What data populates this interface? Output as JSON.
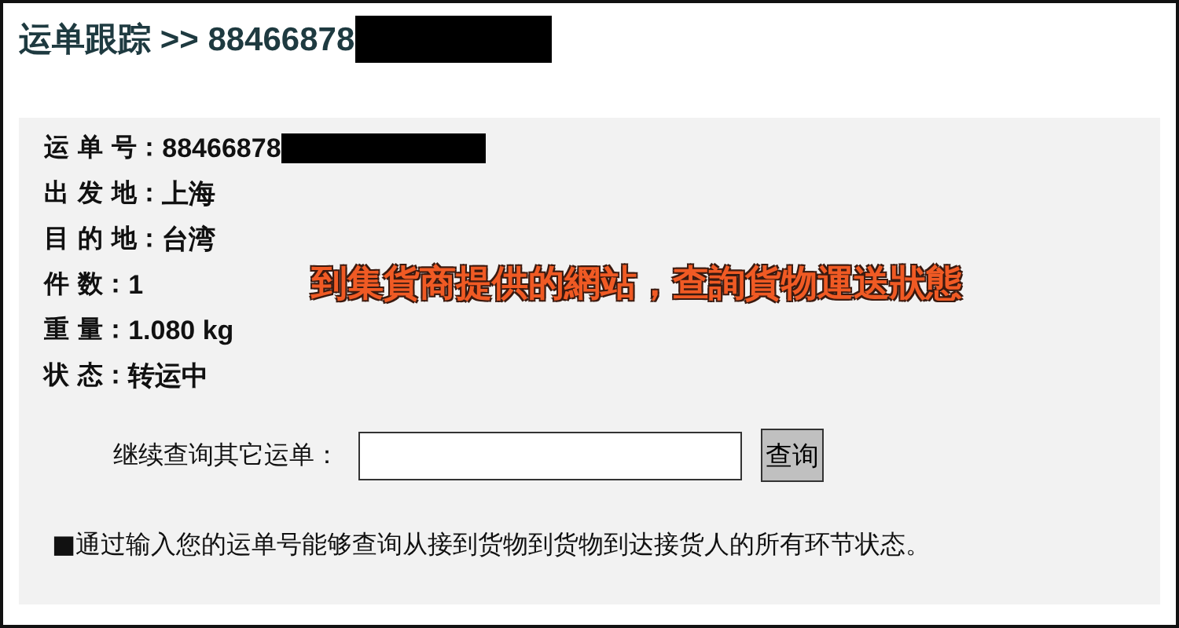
{
  "header": {
    "title": "运单跟踪 >> 88466878",
    "redacted": true
  },
  "details": [
    {
      "label": "运 单 号：",
      "value": "88466878",
      "redacted": true
    },
    {
      "label": "出 发 地：",
      "value": "上海",
      "redacted": false
    },
    {
      "label": "目 的 地：",
      "value": "台湾",
      "redacted": false
    },
    {
      "label": "件 数：",
      "value": "1",
      "redacted": false
    },
    {
      "label": "重 量：",
      "value": "1.080 kg",
      "redacted": false
    },
    {
      "label": "状 态：",
      "value": "转运中",
      "redacted": false
    }
  ],
  "annotation": "到集貨商提供的網站，查詢貨物運送狀態",
  "query": {
    "label": "继续查询其它运单：",
    "button": "查询"
  },
  "note": "■通过输入您的运单号能够查询从接到货物到货物到达接货人的所有环节状态。"
}
